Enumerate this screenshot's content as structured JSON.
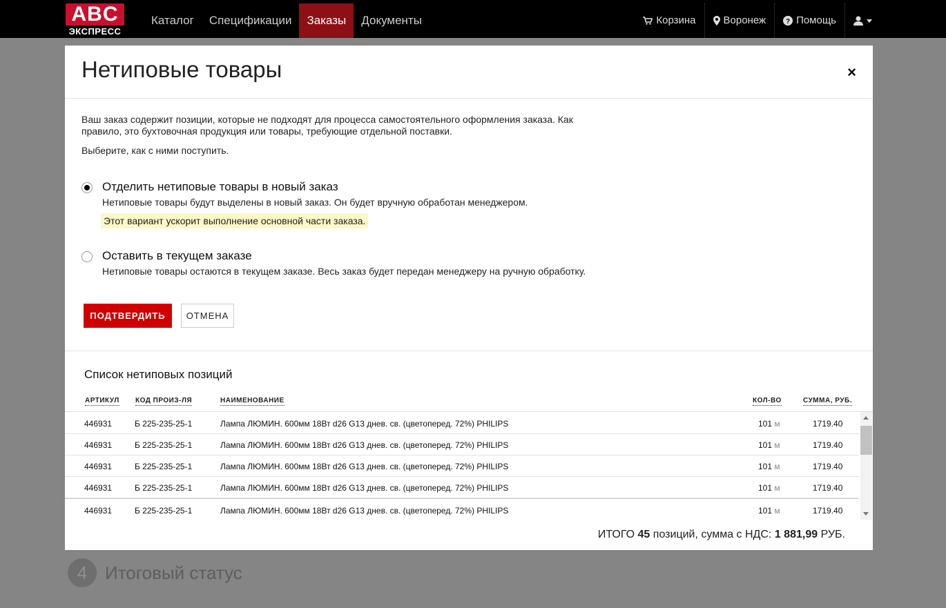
{
  "navbar": {
    "logo_top": "ABC",
    "logo_bottom": "ЭКСПРЕСС",
    "items": [
      {
        "label": "Каталог"
      },
      {
        "label": "Спецификации"
      },
      {
        "label": "Заказы"
      },
      {
        "label": "Документы"
      }
    ],
    "active_item": "Заказы",
    "right": {
      "cart": "Корзина",
      "city": "Воронеж",
      "help": "Помощь"
    }
  },
  "background": {
    "step_number": "4",
    "step_title": "Итоговый статус"
  },
  "modal": {
    "title": "Нетиповые товары",
    "close_symbol": "×",
    "intro": "Ваш заказ содержит позиции, которые не подходят для процесса самостоятельного оформления заказа. Как правило, это бухтовочная продукция или товары, требующие отдельной поставки.",
    "intro2": "Выберите, как с ними поступить.",
    "options": [
      {
        "label": "Отделить нетиповые товары в новый заказ",
        "description": "Нетиповые товары будут выделены в новый заказ. Он будет вручную обработан менеджером.",
        "note": "Этот вариант ускорит выполнение основной части заказа.",
        "checked": true
      },
      {
        "label": "Оставить в текущем заказе",
        "description": "Нетиповые товары остаются в текущем заказе. Весь заказ будет передан менеджеру на ручную обработку.",
        "checked": false
      }
    ],
    "confirm_label": "ПОДТВЕРДИТЬ",
    "cancel_label": "ОТМЕНА",
    "list_title": "Список нетиповых позиций",
    "columns": {
      "article": "АРТИКУЛ",
      "code": "КОД ПРОИЗ-ЛЯ",
      "name": "НАИМЕНОВАНИЕ",
      "qty": "КОЛ-ВО",
      "sum": "СУММА, РУБ."
    },
    "rows": [
      {
        "article": "446931",
        "code": "Б 225-235-25-1",
        "name": "Лампа ЛЮМИН. 600мм 18Вт d26 G13 днев. св. (цветоперед. 72%) PHILIPS",
        "qty": "101",
        "unit": "м",
        "sum": "1719.40"
      },
      {
        "article": "446931",
        "code": "Б 225-235-25-1",
        "name": "Лампа ЛЮМИН. 600мм 18Вт d26 G13 днев. св. (цветоперед. 72%) PHILIPS",
        "qty": "101",
        "unit": "м",
        "sum": "1719.40"
      },
      {
        "article": "446931",
        "code": "Б 225-235-25-1",
        "name": "Лампа ЛЮМИН. 600мм 18Вт d26 G13 днев. св. (цветоперед. 72%) PHILIPS",
        "qty": "101",
        "unit": "м",
        "sum": "1719.40"
      },
      {
        "article": "446931",
        "code": "Б 225-235-25-1",
        "name": "Лампа ЛЮМИН. 600мм 18Вт d26 G13 днев. св. (цветоперед. 72%) PHILIPS",
        "qty": "101",
        "unit": "м",
        "sum": "1719.40"
      },
      {
        "article": "446931",
        "code": "Б 225-235-25-1",
        "name": "Лампа ЛЮМИН. 600мм 18Вт d26 G13 днев. св. (цветоперед. 72%) PHILIPS",
        "qty": "101",
        "unit": "м",
        "sum": "1719.40"
      }
    ],
    "total": {
      "prefix": "ИТОГО",
      "count": "45",
      "middle": "позиций, сумма с НДС:",
      "amount": "1 881,99",
      "currency": "РУБ."
    }
  },
  "colors": {
    "brand_red": "#c8102e",
    "confirm_button": "#d00000",
    "active_nav": "#8c1015",
    "note_highlight": "#fcf8c8",
    "overlay": "#858585"
  }
}
